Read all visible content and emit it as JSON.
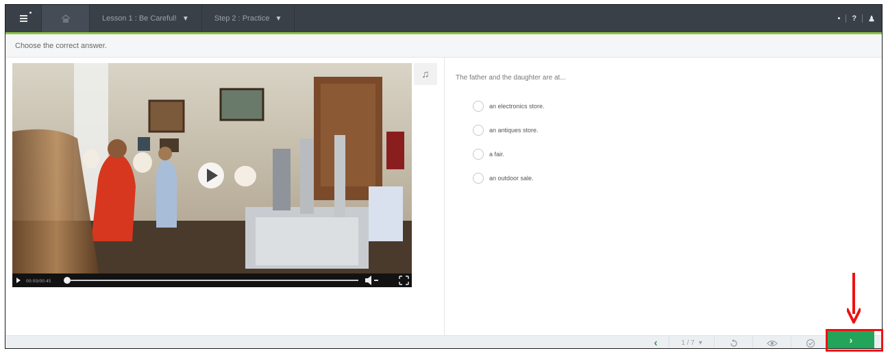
{
  "nav": {
    "lesson_label": "Lesson 1 : Be Careful!",
    "step_label": "Step 2 : Practice",
    "right_flag": "▪",
    "right_help": "?",
    "right_user": "♟"
  },
  "instruction": "Choose the correct answer.",
  "video": {
    "time": "00:00/00:45"
  },
  "question": {
    "text": "The father and the daughter are at...",
    "options": [
      {
        "label": "an electronics store."
      },
      {
        "label": "an antiques store."
      },
      {
        "label": "a fair."
      },
      {
        "label": "an outdoor sale."
      }
    ]
  },
  "toolbar": {
    "prev": "‹",
    "page": "1 / 7",
    "next": "›"
  },
  "colors": {
    "nav_bg": "#3a4048",
    "accent": "#8cc63f",
    "next_button": "#22a55a",
    "annotation": "#ee1111"
  }
}
